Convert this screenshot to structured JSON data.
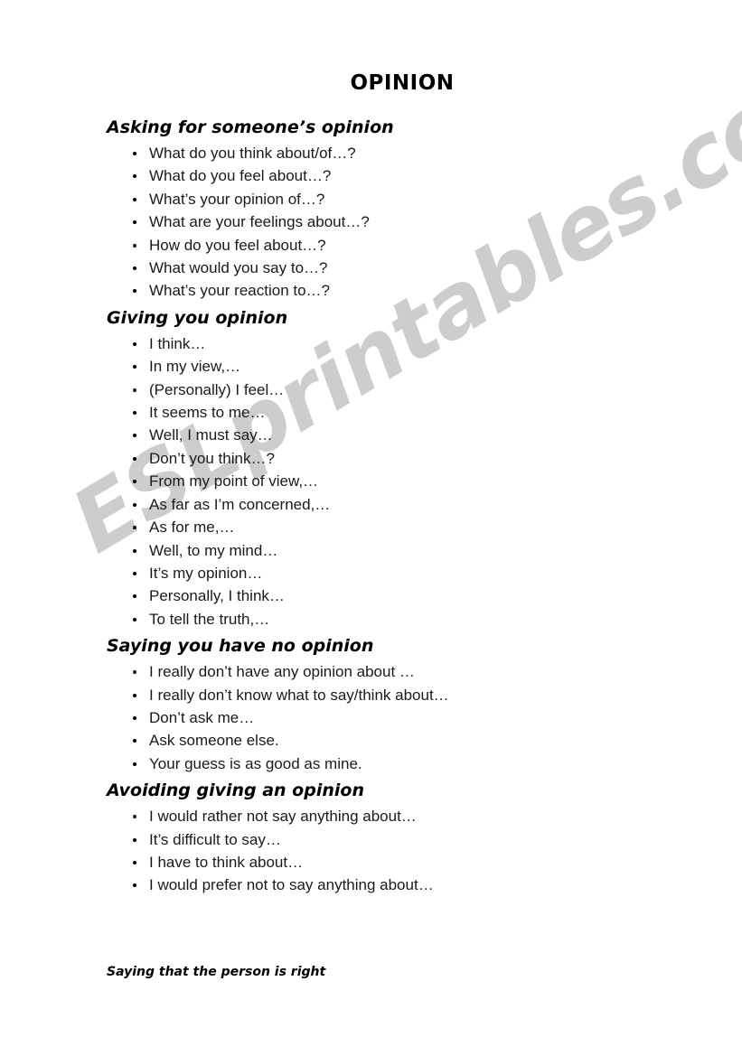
{
  "document": {
    "title": "OPINION",
    "watermark": "ESLprintables.com",
    "watermark_color": "#cdcdcd",
    "footer_note": "Saying that the person is right"
  },
  "sections": [
    {
      "heading": "Asking for someone’s opinion",
      "items": [
        "What do you think about/of…?",
        "What do you feel about…?",
        "What’s your opinion of…?",
        "What are your feelings about…?",
        "How do you feel about…?",
        "What would you say to…?",
        "What’s your reaction to…?"
      ]
    },
    {
      "heading": "Giving you opinion",
      "items": [
        "I think…",
        "In my view,…",
        "(Personally) I feel…",
        "It seems to me…",
        "Well, I must say…",
        "Don’t you think…?",
        "From my point of view,…",
        "As far as I’m concerned,…",
        "As for me,…",
        "Well, to my mind…",
        "It’s my opinion…",
        "Personally, I think…",
        "To tell the truth,…"
      ]
    },
    {
      "heading": "Saying you have no opinion",
      "items": [
        "I really don’t have any opinion about …",
        "I really don’t know what to say/think about…",
        "Don’t ask me…",
        "Ask someone else.",
        "Your guess is as good as mine."
      ]
    },
    {
      "heading": "Avoiding giving an opinion",
      "items": [
        "I would rather not say anything about…",
        "It’s difficult to say…",
        "I have to think about…",
        "I would prefer not to say anything about…"
      ]
    }
  ]
}
